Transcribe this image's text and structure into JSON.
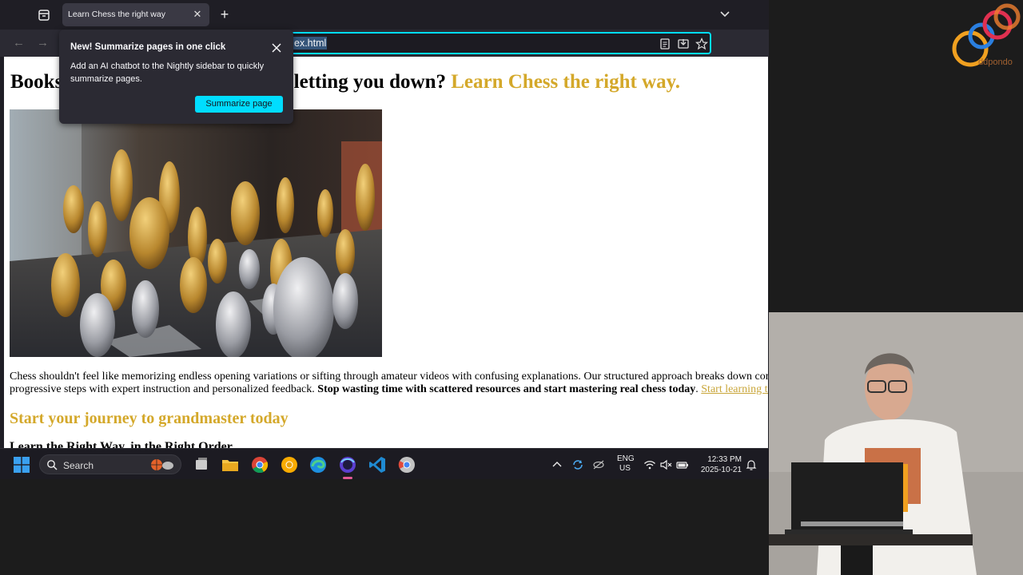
{
  "browser": {
    "tab": {
      "title": "Learn Chess the right way",
      "close_glyph": "✕"
    },
    "new_tab_glyph": "+",
    "url": "ex.html",
    "nav": {
      "back_glyph": "←",
      "forward_glyph": "→"
    }
  },
  "page": {
    "heading_part1": "Books",
    "heading_part2": "e letting you down?",
    "heading_accent": "Learn Chess the right way.",
    "accent_color": "#d4a82a",
    "intro_text": "Chess shouldn't feel like memorizing endless opening variations or sifting through amateur videos with confusing explanations. Our structured approach breaks down complex st",
    "intro_text_line2": "progressive steps with expert instruction and personalized feedback. ",
    "intro_bold": "Stop wasting time with scattered resources and start mastering real chess today",
    "intro_period": ".",
    "intro_link": "Start learning today!",
    "subheading": "Start your journey to grandmaster today",
    "subsubheading": "Learn the Right Way, in the Right Order"
  },
  "popup": {
    "title": "New! Summarize pages in one click",
    "body": "Add an AI chatbot to the Nightly sidebar to quickly summarize pages.",
    "button_label": "Summarize page",
    "accent_color": "#00ddff"
  },
  "taskbar": {
    "search_label": "Search",
    "lang_line1": "ENG",
    "lang_line2": "US",
    "time": "12:33 PM",
    "date": "2025-10-21"
  },
  "overlay": {
    "logo_text": "ddpondo"
  }
}
